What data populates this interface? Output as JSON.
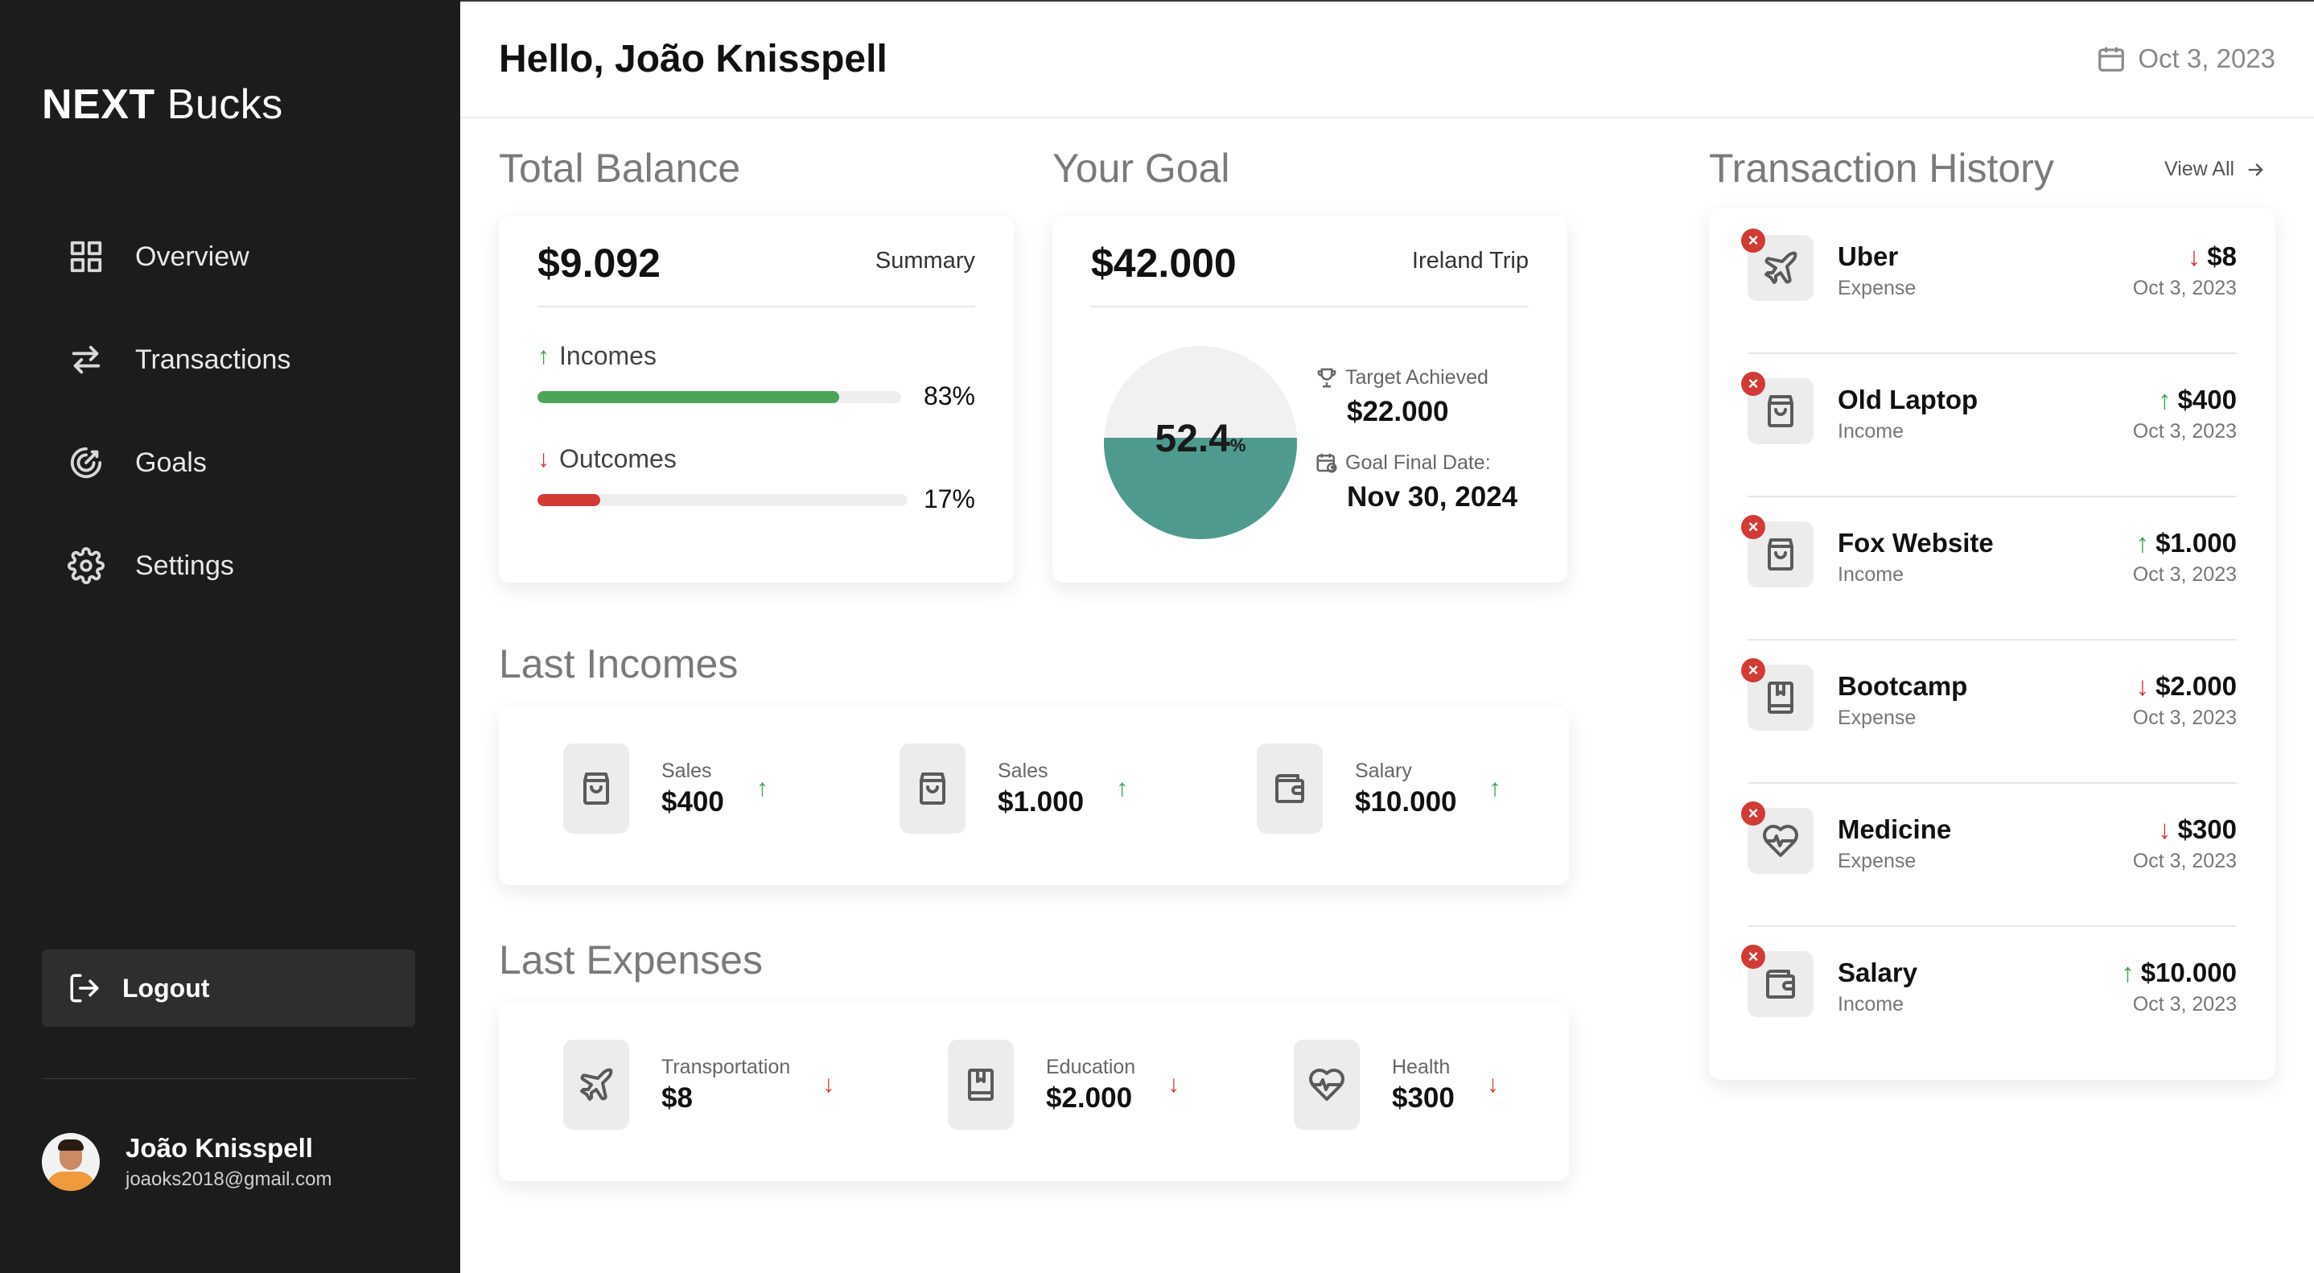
{
  "app": {
    "logo_bold": "NEXT",
    "logo_light": "Bucks"
  },
  "sidebar": {
    "items": [
      {
        "label": "Overview",
        "icon": "grid-icon"
      },
      {
        "label": "Transactions",
        "icon": "arrows-swap-icon"
      },
      {
        "label": "Goals",
        "icon": "target-icon"
      },
      {
        "label": "Settings",
        "icon": "gear-icon"
      }
    ],
    "logout_label": "Logout",
    "user": {
      "name": "João Knisspell",
      "email": "joaoks2018@gmail.com"
    }
  },
  "header": {
    "greeting": "Hello, João Knisspell",
    "date": "Oct 3, 2023"
  },
  "total_balance": {
    "title": "Total Balance",
    "amount": "$9.092",
    "summary_label": "Summary",
    "incomes": {
      "label": "Incomes",
      "percent_text": "83%",
      "percent": 83,
      "color": "#4aa556"
    },
    "outcomes": {
      "label": "Outcomes",
      "percent_text": "17%",
      "percent": 17,
      "color": "#d23a36"
    }
  },
  "goal": {
    "title": "Your Goal",
    "amount": "$42.000",
    "name": "Ireland Trip",
    "progress_value": "52.4",
    "progress_unit": "%",
    "progress": 52.4,
    "progress_color": "#4f9a8f",
    "target_label": "Target Achieved",
    "target_value": "$22.000",
    "final_date_label": "Goal Final Date:",
    "final_date_value": "Nov 30, 2024"
  },
  "last_incomes": {
    "title": "Last Incomes",
    "items": [
      {
        "label": "Sales",
        "value": "$400",
        "icon": "shopping-bag-icon",
        "direction": "↑"
      },
      {
        "label": "Sales",
        "value": "$1.000",
        "icon": "shopping-bag-icon",
        "direction": "↑"
      },
      {
        "label": "Salary",
        "value": "$10.000",
        "icon": "wallet-icon",
        "direction": "↑"
      }
    ]
  },
  "last_expenses": {
    "title": "Last Expenses",
    "items": [
      {
        "label": "Transportation",
        "value": "$8",
        "icon": "airplane-icon",
        "direction": "↓"
      },
      {
        "label": "Education",
        "value": "$2.000",
        "icon": "book-icon",
        "direction": "↓"
      },
      {
        "label": "Health",
        "value": "$300",
        "icon": "heart-pulse-icon",
        "direction": "↓"
      }
    ]
  },
  "transaction_history": {
    "title": "Transaction History",
    "view_all_label": "View All",
    "delete_glyph": "×",
    "items": [
      {
        "name": "Uber",
        "type": "Expense",
        "amount": "$8",
        "direction": "↓",
        "date": "Oct 3, 2023",
        "icon": "airplane-icon"
      },
      {
        "name": "Old Laptop",
        "type": "Income",
        "amount": "$400",
        "direction": "↑",
        "date": "Oct 3, 2023",
        "icon": "shopping-bag-icon"
      },
      {
        "name": "Fox Website",
        "type": "Income",
        "amount": "$1.000",
        "direction": "↑",
        "date": "Oct 3, 2023",
        "icon": "shopping-bag-icon"
      },
      {
        "name": "Bootcamp",
        "type": "Expense",
        "amount": "$2.000",
        "direction": "↓",
        "date": "Oct 3, 2023",
        "icon": "book-icon"
      },
      {
        "name": "Medicine",
        "type": "Expense",
        "amount": "$300",
        "direction": "↓",
        "date": "Oct 3, 2023",
        "icon": "heart-pulse-icon"
      },
      {
        "name": "Salary",
        "type": "Income",
        "amount": "$10.000",
        "direction": "↑",
        "date": "Oct 3, 2023",
        "icon": "wallet-icon"
      }
    ]
  },
  "colors": {
    "sidebar_bg": "#1c1c1c",
    "income": "#3aa24a",
    "expense": "#d23a36",
    "accent": "#4f9a8f"
  }
}
